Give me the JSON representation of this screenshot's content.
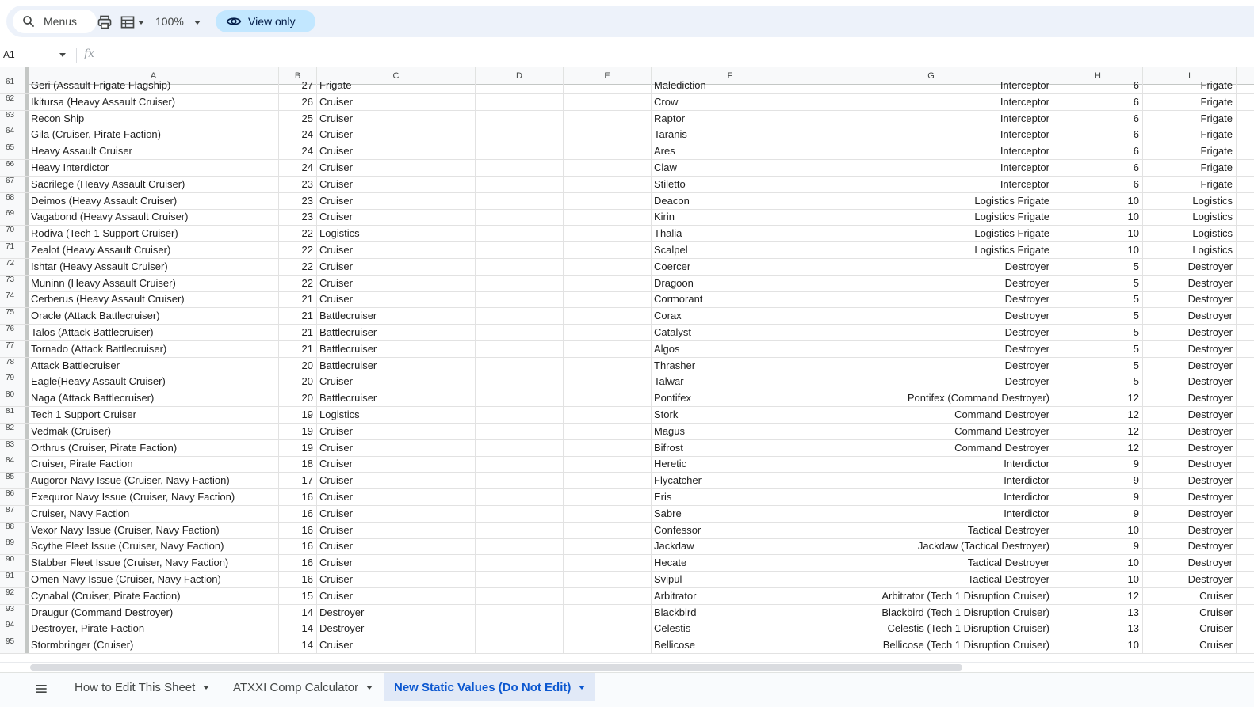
{
  "toolbar": {
    "menus_label": "Menus",
    "zoom": "100%",
    "view_only_label": "View only"
  },
  "formula_bar": {
    "name_box": "A1",
    "fx_label": "fx",
    "formula": ""
  },
  "columns": [
    "A",
    "B",
    "C",
    "D",
    "E",
    "F",
    "G",
    "H",
    "I"
  ],
  "rows": [
    {
      "n": "61",
      "a": "Geri (Assault Frigate Flagship)",
      "b": "27",
      "c": "Frigate",
      "f": "Malediction",
      "g": "Interceptor",
      "h": "6",
      "i": "Frigate"
    },
    {
      "n": "62",
      "a": "Ikitursa (Heavy Assault Cruiser)",
      "b": "26",
      "c": "Cruiser",
      "f": "Crow",
      "g": "Interceptor",
      "h": "6",
      "i": "Frigate"
    },
    {
      "n": "63",
      "a": "Recon Ship",
      "b": "25",
      "c": "Cruiser",
      "f": "Raptor",
      "g": "Interceptor",
      "h": "6",
      "i": "Frigate"
    },
    {
      "n": "64",
      "a": "Gila (Cruiser, Pirate Faction)",
      "b": "24",
      "c": "Cruiser",
      "f": "Taranis",
      "g": "Interceptor",
      "h": "6",
      "i": "Frigate"
    },
    {
      "n": "65",
      "a": "Heavy Assault Cruiser",
      "b": "24",
      "c": "Cruiser",
      "f": "Ares",
      "g": "Interceptor",
      "h": "6",
      "i": "Frigate"
    },
    {
      "n": "66",
      "a": "Heavy Interdictor",
      "b": "24",
      "c": "Cruiser",
      "f": "Claw",
      "g": "Interceptor",
      "h": "6",
      "i": "Frigate"
    },
    {
      "n": "67",
      "a": "Sacrilege (Heavy Assault Cruiser)",
      "b": "23",
      "c": "Cruiser",
      "f": "Stiletto",
      "g": "Interceptor",
      "h": "6",
      "i": "Frigate"
    },
    {
      "n": "68",
      "a": "Deimos (Heavy Assault Cruiser)",
      "b": "23",
      "c": "Cruiser",
      "f": "Deacon",
      "g": "Logistics Frigate",
      "h": "10",
      "i": "Logistics"
    },
    {
      "n": "69",
      "a": "Vagabond (Heavy Assault Cruiser)",
      "b": "23",
      "c": "Cruiser",
      "f": "Kirin",
      "g": "Logistics Frigate",
      "h": "10",
      "i": "Logistics"
    },
    {
      "n": "70",
      "a": "Rodiva (Tech 1 Support Cruiser)",
      "b": "22",
      "c": "Logistics",
      "f": "Thalia",
      "g": "Logistics Frigate",
      "h": "10",
      "i": "Logistics"
    },
    {
      "n": "71",
      "a": "Zealot (Heavy Assault Cruiser)",
      "b": "22",
      "c": "Cruiser",
      "f": "Scalpel",
      "g": "Logistics Frigate",
      "h": "10",
      "i": "Logistics"
    },
    {
      "n": "72",
      "a": "Ishtar (Heavy Assault Cruiser)",
      "b": "22",
      "c": "Cruiser",
      "f": "Coercer",
      "g": "Destroyer",
      "h": "5",
      "i": "Destroyer"
    },
    {
      "n": "73",
      "a": "Muninn (Heavy Assault Cruiser)",
      "b": "22",
      "c": "Cruiser",
      "f": "Dragoon",
      "g": "Destroyer",
      "h": "5",
      "i": "Destroyer"
    },
    {
      "n": "74",
      "a": "Cerberus (Heavy Assault Cruiser)",
      "b": "21",
      "c": "Cruiser",
      "f": "Cormorant",
      "g": "Destroyer",
      "h": "5",
      "i": "Destroyer"
    },
    {
      "n": "75",
      "a": "Oracle (Attack Battlecruiser)",
      "b": "21",
      "c": "Battlecruiser",
      "f": "Corax",
      "g": "Destroyer",
      "h": "5",
      "i": "Destroyer"
    },
    {
      "n": "76",
      "a": "Talos (Attack Battlecruiser)",
      "b": "21",
      "c": "Battlecruiser",
      "f": "Catalyst",
      "g": "Destroyer",
      "h": "5",
      "i": "Destroyer"
    },
    {
      "n": "77",
      "a": "Tornado (Attack Battlecruiser)",
      "b": "21",
      "c": "Battlecruiser",
      "f": "Algos",
      "g": "Destroyer",
      "h": "5",
      "i": "Destroyer"
    },
    {
      "n": "78",
      "a": "Attack Battlecruiser",
      "b": "20",
      "c": "Battlecruiser",
      "f": "Thrasher",
      "g": "Destroyer",
      "h": "5",
      "i": "Destroyer"
    },
    {
      "n": "79",
      "a": "Eagle(Heavy Assault Cruiser)",
      "b": "20",
      "c": "Cruiser",
      "f": "Talwar",
      "g": "Destroyer",
      "h": "5",
      "i": "Destroyer"
    },
    {
      "n": "80",
      "a": "Naga (Attack Battlecruiser)",
      "b": "20",
      "c": "Battlecruiser",
      "f": "Pontifex",
      "g": "Pontifex (Command Destroyer)",
      "h": "12",
      "i": "Destroyer"
    },
    {
      "n": "81",
      "a": "Tech 1 Support Cruiser",
      "b": "19",
      "c": "Logistics",
      "f": "Stork",
      "g": "Command Destroyer",
      "h": "12",
      "i": "Destroyer"
    },
    {
      "n": "82",
      "a": "Vedmak (Cruiser)",
      "b": "19",
      "c": "Cruiser",
      "f": "Magus",
      "g": "Command Destroyer",
      "h": "12",
      "i": "Destroyer"
    },
    {
      "n": "83",
      "a": "Orthrus (Cruiser, Pirate Faction)",
      "b": "19",
      "c": "Cruiser",
      "f": "Bifrost",
      "g": "Command Destroyer",
      "h": "12",
      "i": "Destroyer"
    },
    {
      "n": "84",
      "a": "Cruiser, Pirate Faction",
      "b": "18",
      "c": "Cruiser",
      "f": "Heretic",
      "g": "Interdictor",
      "h": "9",
      "i": "Destroyer"
    },
    {
      "n": "85",
      "a": "Augoror Navy Issue (Cruiser, Navy Faction)",
      "b": "17",
      "c": "Cruiser",
      "f": "Flycatcher",
      "g": "Interdictor",
      "h": "9",
      "i": "Destroyer"
    },
    {
      "n": "86",
      "a": "Exequror Navy Issue (Cruiser, Navy Faction)",
      "b": "16",
      "c": "Cruiser",
      "f": "Eris",
      "g": "Interdictor",
      "h": "9",
      "i": "Destroyer"
    },
    {
      "n": "87",
      "a": "Cruiser, Navy Faction",
      "b": "16",
      "c": "Cruiser",
      "f": "Sabre",
      "g": "Interdictor",
      "h": "9",
      "i": "Destroyer"
    },
    {
      "n": "88",
      "a": "Vexor Navy Issue (Cruiser, Navy Faction)",
      "b": "16",
      "c": "Cruiser",
      "f": "Confessor",
      "g": "Tactical Destroyer",
      "h": "10",
      "i": "Destroyer"
    },
    {
      "n": "89",
      "a": "Scythe Fleet Issue (Cruiser, Navy Faction)",
      "b": "16",
      "c": "Cruiser",
      "f": "Jackdaw",
      "g": "Jackdaw (Tactical Destroyer)",
      "h": "9",
      "i": "Destroyer"
    },
    {
      "n": "90",
      "a": "Stabber Fleet Issue (Cruiser, Navy Faction)",
      "b": "16",
      "c": "Cruiser",
      "f": "Hecate",
      "g": "Tactical Destroyer",
      "h": "10",
      "i": "Destroyer"
    },
    {
      "n": "91",
      "a": "Omen Navy Issue (Cruiser, Navy Faction)",
      "b": "16",
      "c": "Cruiser",
      "f": "Svipul",
      "g": "Tactical Destroyer",
      "h": "10",
      "i": "Destroyer"
    },
    {
      "n": "92",
      "a": "Cynabal (Cruiser, Pirate Faction)",
      "b": "15",
      "c": "Cruiser",
      "f": "Arbitrator",
      "g": "Arbitrator (Tech 1 Disruption Cruiser)",
      "h": "12",
      "i": "Cruiser"
    },
    {
      "n": "93",
      "a": "Draugur (Command Destroyer)",
      "b": "14",
      "c": "Destroyer",
      "f": "Blackbird",
      "g": "Blackbird (Tech 1 Disruption Cruiser)",
      "h": "13",
      "i": "Cruiser"
    },
    {
      "n": "94",
      "a": "Destroyer, Pirate Faction",
      "b": "14",
      "c": "Destroyer",
      "f": "Celestis",
      "g": "Celestis (Tech 1 Disruption Cruiser)",
      "h": "13",
      "i": "Cruiser"
    },
    {
      "n": "95",
      "a": "Stormbringer (Cruiser)",
      "b": "14",
      "c": "Cruiser",
      "f": "Bellicose",
      "g": "Bellicose (Tech 1 Disruption Cruiser)",
      "h": "10",
      "i": "Cruiser"
    }
  ],
  "sheet_tabs": [
    {
      "label": "How to Edit This Sheet",
      "active": false
    },
    {
      "label": "ATXXI Comp Calculator",
      "active": false
    },
    {
      "label": "New Static Values (Do Not Edit)",
      "active": true
    }
  ],
  "colors": {
    "toolbar_bg": "#edf2fa",
    "view_only_bg": "#c2e7ff",
    "active_tab_text": "#0b57d0",
    "active_tab_bg": "#e1e9f7",
    "header_bg": "#f8f9fa"
  }
}
